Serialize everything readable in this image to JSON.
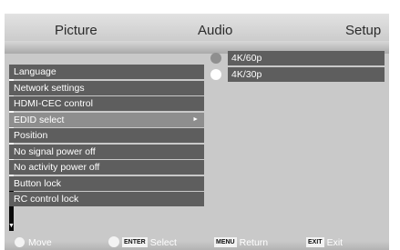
{
  "tabs": {
    "picture": "Picture",
    "audio": "Audio",
    "setup": "Setup"
  },
  "menu": {
    "items": [
      "Language",
      "Network settings",
      "HDMI-CEC control",
      "EDID select",
      "Position",
      "No signal power off",
      "No activity power off",
      "Button lock",
      "RC control lock"
    ],
    "selected_index": 3,
    "submenu_arrow": "►"
  },
  "options": {
    "items": [
      "4K/60p",
      "4K/30p"
    ],
    "selected_index": 0
  },
  "help": {
    "move": "Move",
    "enter_key": "ENTER",
    "select": "Select",
    "menu_key": "MENU",
    "return": "Return",
    "exit_key": "EXIT",
    "exit": "Exit"
  },
  "scroll": {
    "up_glyph": "▲",
    "down_glyph": "▼"
  },
  "colors": {
    "item_bg": "#5e5e5e",
    "selected_bg": "#8e8e8e",
    "panel_bg": "#c9c9c9"
  }
}
